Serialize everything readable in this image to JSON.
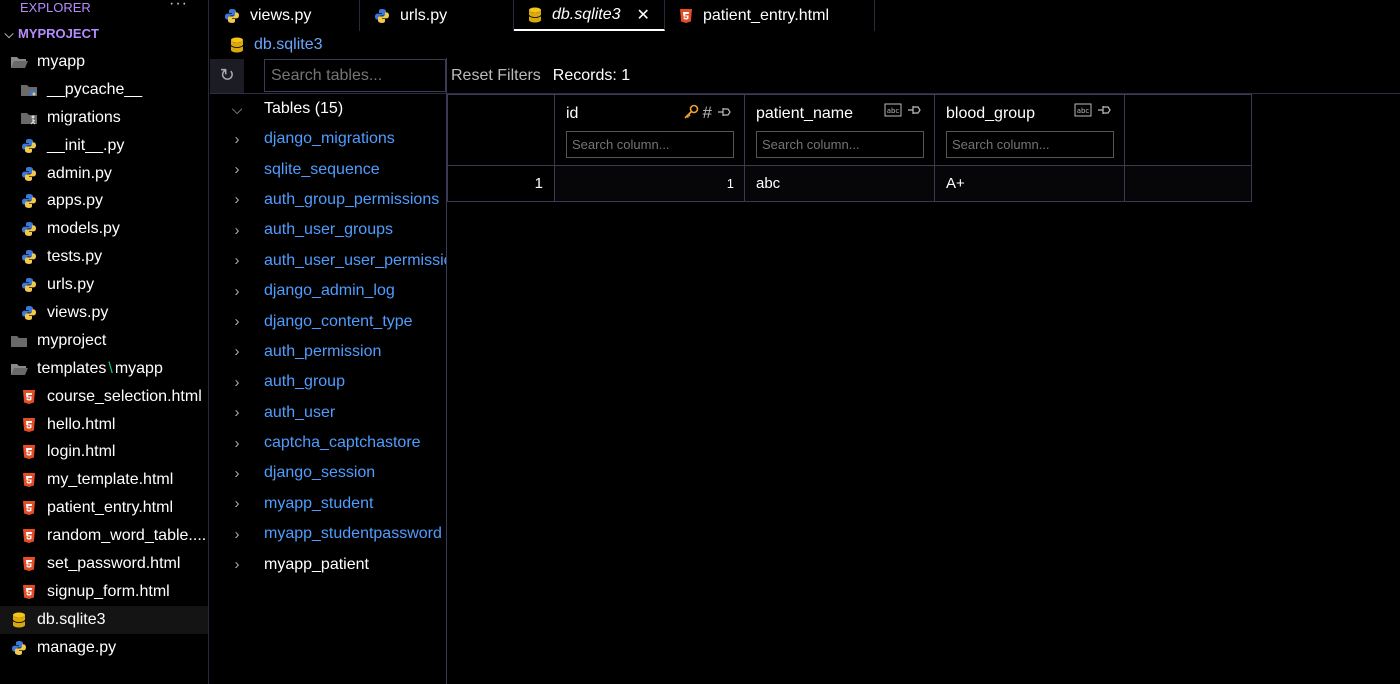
{
  "explorer": {
    "title": "EXPLORER",
    "more": "···",
    "root": "MYPROJECT",
    "items": [
      {
        "label": "myapp",
        "icon": "folder-open-icon"
      },
      {
        "label": "__pycache__",
        "icon": "pycache-folder-icon"
      },
      {
        "label": "migrations",
        "icon": "migrations-folder-icon"
      },
      {
        "label": "__init__.py",
        "icon": "python-icon"
      },
      {
        "label": "admin.py",
        "icon": "python-icon"
      },
      {
        "label": "apps.py",
        "icon": "python-icon"
      },
      {
        "label": "models.py",
        "icon": "python-icon"
      },
      {
        "label": "tests.py",
        "icon": "python-icon"
      },
      {
        "label": "urls.py",
        "icon": "python-icon"
      },
      {
        "label": "views.py",
        "icon": "python-icon"
      },
      {
        "label": "myproject",
        "icon": "folder-icon"
      },
      {
        "label": "templates",
        "label2": "myapp",
        "sep": "\\",
        "icon": "folder-open-icon"
      },
      {
        "label": "course_selection.html",
        "icon": "html-icon"
      },
      {
        "label": "hello.html",
        "icon": "html-icon"
      },
      {
        "label": "login.html",
        "icon": "html-icon"
      },
      {
        "label": "my_template.html",
        "icon": "html-icon"
      },
      {
        "label": "patient_entry.html",
        "icon": "html-icon"
      },
      {
        "label": "random_word_table....",
        "icon": "html-icon"
      },
      {
        "label": "set_password.html",
        "icon": "html-icon"
      },
      {
        "label": "signup_form.html",
        "icon": "html-icon"
      },
      {
        "label": "db.sqlite3",
        "icon": "database-icon"
      },
      {
        "label": "manage.py",
        "icon": "python-icon"
      }
    ]
  },
  "tabs": [
    {
      "label": "views.py",
      "icon": "python-icon"
    },
    {
      "label": "urls.py",
      "icon": "python-icon"
    },
    {
      "label": "db.sqlite3",
      "icon": "database-icon",
      "close": "✕"
    },
    {
      "label": "patient_entry.html",
      "icon": "html-icon"
    }
  ],
  "breadcrumb": "db.sqlite3",
  "tables_panel": {
    "search_placeholder": "Search tables...",
    "heading": "Tables (15)",
    "tables": [
      "django_migrations",
      "sqlite_sequence",
      "auth_group_permissions",
      "auth_user_groups",
      "auth_user_user_permissions",
      "django_admin_log",
      "django_content_type",
      "auth_permission",
      "auth_group",
      "auth_user",
      "captcha_captchastore",
      "django_session",
      "myapp_student",
      "myapp_studentpassword",
      "myapp_patient"
    ]
  },
  "grid": {
    "reset_filters": "Reset Filters",
    "records": "Records: 1",
    "columns": [
      {
        "name": "id",
        "icons": [
          "key-icon",
          "hash-icon",
          "pin-icon"
        ]
      },
      {
        "name": "patient_name",
        "icons": [
          "text-type-icon",
          "pin-icon"
        ]
      },
      {
        "name": "blood_group",
        "icons": [
          "text-type-icon",
          "pin-icon"
        ]
      }
    ],
    "column_search_placeholder": "Search column...",
    "rows": [
      {
        "rownum": "1",
        "id": "1",
        "patient_name": "abc",
        "blood_group": "A+"
      }
    ]
  },
  "colors": {
    "accent": "#b58cff",
    "link": "#4f9dff",
    "python_blue": "#3b78d8",
    "python_yellow": "#f2c94c",
    "html_red": "#e44d26",
    "db_yellow": "#f5c518",
    "key_orange": "#f0a030"
  }
}
